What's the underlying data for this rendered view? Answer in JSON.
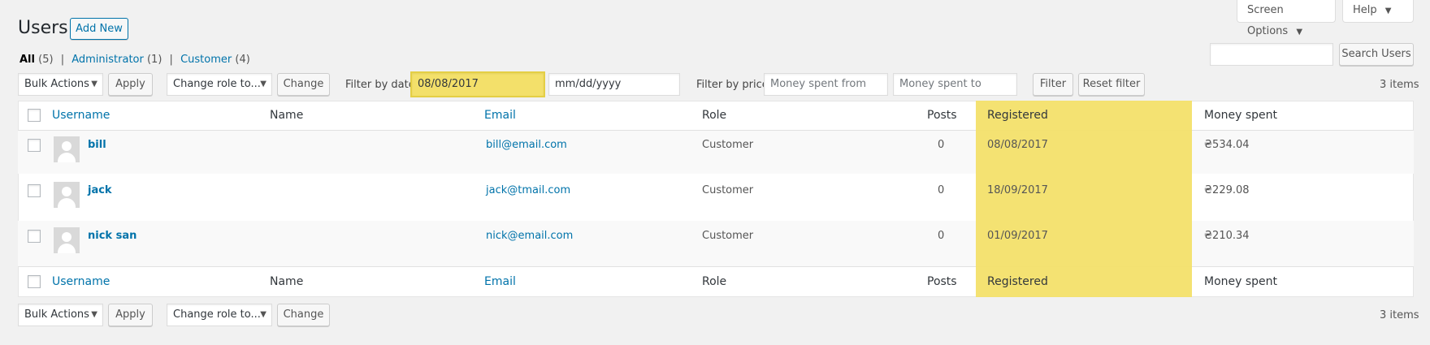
{
  "page": {
    "title": "Users",
    "add_new": "Add New"
  },
  "header_tabs": {
    "screen_options": "Screen Options",
    "help": "Help"
  },
  "views": {
    "all": {
      "label": "All",
      "count": "(5)"
    },
    "administrator": {
      "label": "Administrator",
      "count": "(1)"
    },
    "customer": {
      "label": "Customer",
      "count": "(4)"
    }
  },
  "search": {
    "button": "Search Users",
    "value": ""
  },
  "toolbar_top": {
    "bulk_actions": "Bulk Actions",
    "apply": "Apply",
    "change_role": "Change role to...",
    "change": "Change",
    "filter_by_date_label": "Filter by date",
    "date_from_value": "08/08/2017",
    "date_to_placeholder": "mm/dd/yyyy",
    "filter_by_price_label": "Filter by price",
    "money_from_placeholder": "Money spent from",
    "money_to_placeholder": "Money spent to",
    "filter": "Filter",
    "reset_filter": "Reset filter",
    "items_count": "3 items"
  },
  "table": {
    "columns": {
      "username": "Username",
      "name": "Name",
      "email": "Email",
      "role": "Role",
      "posts": "Posts",
      "registered": "Registered",
      "money": "Money spent"
    },
    "rows": [
      {
        "username": "bill",
        "name": "",
        "email": "bill@email.com",
        "role": "Customer",
        "posts": "0",
        "registered": "08/08/2017",
        "money": "₴534.04"
      },
      {
        "username": "jack",
        "name": "",
        "email": "jack@tmail.com",
        "role": "Customer",
        "posts": "0",
        "registered": "18/09/2017",
        "money": "₴229.08"
      },
      {
        "username": "nick san",
        "name": "",
        "email": "nick@email.com",
        "role": "Customer",
        "posts": "0",
        "registered": "01/09/2017",
        "money": "₴210.34"
      }
    ]
  },
  "toolbar_bottom": {
    "bulk_actions": "Bulk Actions",
    "apply": "Apply",
    "change_role": "Change role to...",
    "change": "Change",
    "items_count": "3 items"
  },
  "colors": {
    "highlight": "#f3e06a",
    "link": "#0073aa",
    "background": "#f1f1f1"
  },
  "icons": {
    "dropdown": "caret-down-icon",
    "avatar": "user-avatar-icon"
  }
}
